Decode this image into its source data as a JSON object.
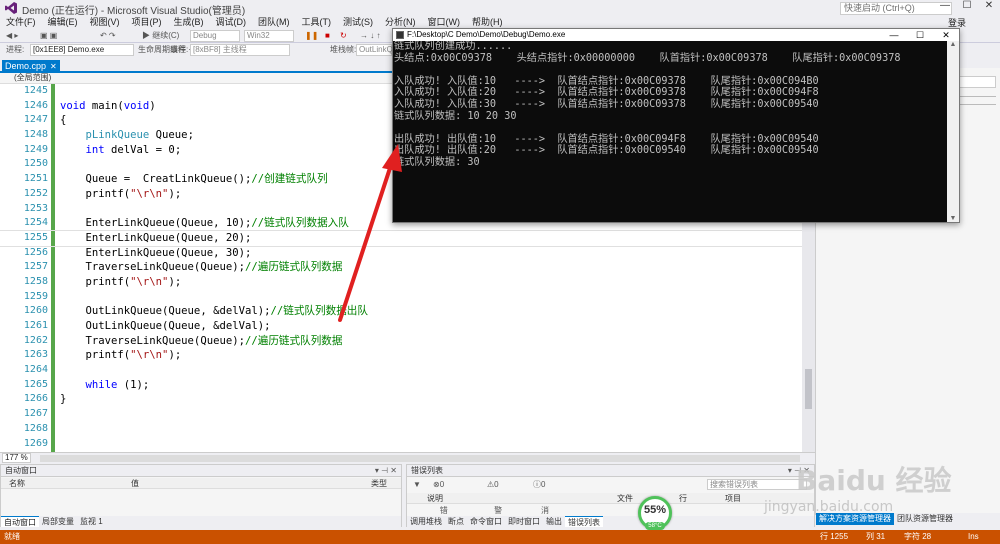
{
  "window": {
    "title": "Demo (正在运行) - Microsoft Visual Studio(管理员)",
    "quick_launch_placeholder": "快速启动 (Ctrl+Q)",
    "sign_in": "登录"
  },
  "menu": [
    "文件(F)",
    "编辑(E)",
    "视图(V)",
    "项目(P)",
    "生成(B)",
    "调试(D)",
    "团队(M)",
    "工具(T)",
    "测试(S)",
    "分析(N)",
    "窗口(W)",
    "帮助(H)"
  ],
  "toolbar": {
    "continue_label": "继续(C)",
    "config": "Debug",
    "platform": "Win32",
    "process_label": "进程:",
    "process_value": "[0x1EE8] Demo.exe",
    "lifecycle_label": "生命周期事件 ·",
    "thread_label": "线程:",
    "thread_value": "[8xBF8] 主线程",
    "stack_label": "堆栈帧:",
    "stack_value": "OutLinkQueue"
  },
  "editor": {
    "tab_label": "Demo.cpp",
    "scope": "(全局范围)",
    "zoom": "177 %",
    "lines": [
      {
        "n": "1245",
        "code": ""
      },
      {
        "n": "1246",
        "code": "void main(void)"
      },
      {
        "n": "1247",
        "code": "{"
      },
      {
        "n": "1248",
        "code": "    pLinkQueue Queue;"
      },
      {
        "n": "1249",
        "code": "    int delVal = 0;"
      },
      {
        "n": "1250",
        "code": ""
      },
      {
        "n": "1251",
        "code": "    Queue =  CreatLinkQueue();//创建链式队列"
      },
      {
        "n": "1252",
        "code": "    printf(\"\\r\\n\");"
      },
      {
        "n": "1253",
        "code": ""
      },
      {
        "n": "1254",
        "code": "    EnterLinkQueue(Queue, 10);//链式队列数据入队"
      },
      {
        "n": "1255",
        "code": "    EnterLinkQueue(Queue, 20);"
      },
      {
        "n": "1256",
        "code": "    EnterLinkQueue(Queue, 30);"
      },
      {
        "n": "1257",
        "code": "    TraverseLinkQueue(Queue);//遍历链式队列数据"
      },
      {
        "n": "1258",
        "code": "    printf(\"\\r\\n\");"
      },
      {
        "n": "1259",
        "code": ""
      },
      {
        "n": "1260",
        "code": "    OutLinkQueue(Queue, &delVal);//链式队列数据出队"
      },
      {
        "n": "1261",
        "code": "    OutLinkQueue(Queue, &delVal);"
      },
      {
        "n": "1262",
        "code": "    TraverseLinkQueue(Queue);//遍历链式队列数据"
      },
      {
        "n": "1263",
        "code": "    printf(\"\\r\\n\");"
      },
      {
        "n": "1264",
        "code": ""
      },
      {
        "n": "1265",
        "code": "    while (1);"
      },
      {
        "n": "1266",
        "code": "}"
      },
      {
        "n": "1267",
        "code": ""
      },
      {
        "n": "1268",
        "code": ""
      },
      {
        "n": "1269",
        "code": ""
      }
    ]
  },
  "console": {
    "title": "F:\\Desktop\\C Demo\\Demo\\Debug\\Demo.exe",
    "lines": [
      "链式队列创建成功......",
      "头结点:0x00C09378    头结点指针:0x00000000    队首指针:0x00C09378    队尾指针:0x00C09378",
      "",
      "入队成功! 入队值:10   ---->  队首结点指针:0x00C09378    队尾指针:0x00C094B0",
      "入队成功! 入队值:20   ---->  队首结点指针:0x00C09378    队尾指针:0x00C094F8",
      "入队成功! 入队值:30   ---->  队首结点指针:0x00C09378    队尾指针:0x00C09540",
      "链式队列数据: 10 20 30",
      "",
      "出队成功! 出队值:10   ---->  队首结点指针:0x00C094F8    队尾指针:0x00C09540",
      "出队成功! 出队值:20   ---->  队首结点指针:0x00C09540    队尾指针:0x00C09540",
      "链式队列数据: 30"
    ]
  },
  "autos": {
    "title": "自动窗口",
    "col_name": "名称",
    "col_value": "值",
    "col_type": "类型",
    "tabs": [
      "自动窗口",
      "局部变量",
      "监视 1"
    ]
  },
  "errors": {
    "title": "错误列表",
    "errors_count": "0 个错误",
    "warnings_count": "0 个警告",
    "messages_count": "0 个消息",
    "search_placeholder": "搜索错误列表",
    "col_desc": "说明",
    "col_file": "文件",
    "col_line": "行",
    "col_project": "项目",
    "tabs": [
      "调用堆栈",
      "断点",
      "命令窗口",
      "即时窗口",
      "输出",
      "错误列表"
    ]
  },
  "right_panel": {
    "tabs": [
      "解决方案资源管理器",
      "团队资源管理器"
    ]
  },
  "perf": {
    "percent": "55%",
    "temp": "58°C"
  },
  "status": {
    "left": "就绪",
    "row": "行 1255",
    "col": "列 31",
    "char": "字符 28",
    "mode": "Ins"
  },
  "watermark": {
    "text": "Baidu 经验",
    "sub": "jingyan.baidu.com"
  },
  "colors": {
    "accent": "#007acc",
    "status": "#ca5100",
    "keyword": "#0000ff",
    "type": "#2b91af",
    "comment": "#008000",
    "string": "#a31515"
  }
}
